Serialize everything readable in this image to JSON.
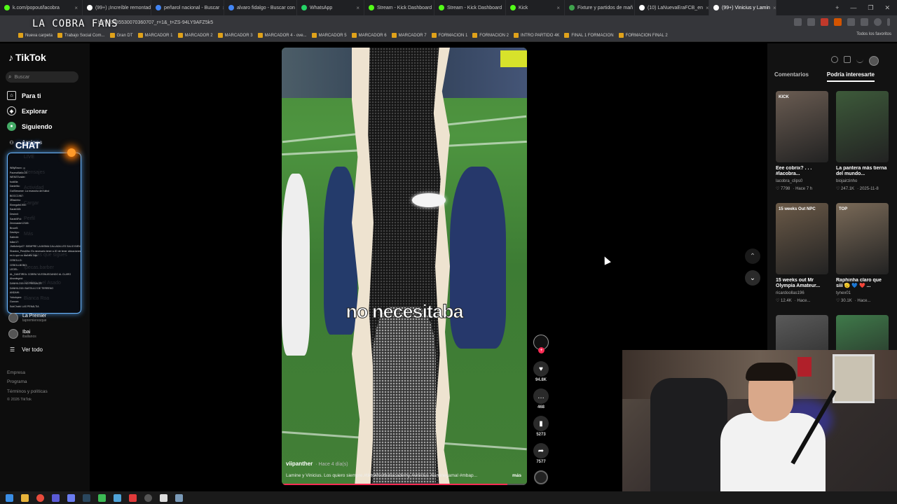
{
  "browser": {
    "tabs": [
      {
        "title": "k.com/popout/lacobra",
        "color": "#53fc18"
      },
      {
        "title": "(99+) ¡Increíble remontada",
        "color": "#ffffff"
      },
      {
        "title": "peñarol nacional - Buscar",
        "color": "#4285f4"
      },
      {
        "title": "alvaro fidalgo - Buscar con",
        "color": "#4285f4"
      },
      {
        "title": "WhatsApp",
        "color": "#25d366"
      },
      {
        "title": "Stream - Kick Dashboard",
        "color": "#53fc18"
      },
      {
        "title": "Stream - Kick Dashboard",
        "color": "#53fc18"
      },
      {
        "title": "Kick",
        "color": "#53fc18"
      },
      {
        "title": "Fixture y partidos de mañ",
        "color": "#3fa34d"
      },
      {
        "title": "(10) LaNuevaEraFCB_en",
        "color": "#ffffff"
      },
      {
        "title": "(99+) Vinicius y Lamin",
        "color": "#ffffff"
      }
    ],
    "url": "b/7610885530070360707_r=1&_t=ZS-94LY9AFZ5k5",
    "bookmarks": [
      "Nueva carpeta",
      "Trabajo Social Com...",
      "Gran DT",
      "MARCADOR 1",
      "MARCADOR 2",
      "MARCADOR 3",
      "MARCADOR 4 - ove...",
      "MARCADOR 5",
      "MARCADOR 6",
      "MARCADOR 7",
      "FORMACION 1",
      "FORMACION 2",
      "INTRO PARTIDO 4K",
      "FINAL 1 FORMACION",
      "FORMACION FINAL 2"
    ],
    "all_favorites": "Todos los favoritos"
  },
  "overlay": {
    "title": "LA COBRA FANS",
    "chat_title": "CHAT"
  },
  "sidebar": {
    "logo": "TikTok",
    "search_placeholder": "Buscar",
    "nav": [
      {
        "label": "Para ti",
        "icon": "home-icon"
      },
      {
        "label": "Explorar",
        "icon": "compass-icon"
      },
      {
        "label": "Siguiendo",
        "icon": "following-icon"
      },
      {
        "label": "Amigos",
        "icon": "friends-icon"
      }
    ],
    "ghost_items": [
      "LIVE",
      "Mensajes",
      "Actividad",
      "Cargar",
      "Perfil",
      "Más",
      "Cuentas que sigues",
      "Ipecas.barber",
      "Pedro y el Asado",
      "Bianca Roa"
    ],
    "followed": [
      {
        "name": "La Premier",
        "handle": "lapremieresque"
      },
      {
        "name": "Ibai",
        "handle": "iballanos"
      }
    ],
    "see_all": "Ver todo",
    "footer": [
      "Empresa",
      "Programa",
      "Términos y políticas",
      "© 2026 TikTok"
    ]
  },
  "video": {
    "caption": "no necesitaba",
    "author": "viipanther",
    "time": "· Hace 4 día(s)",
    "description": "Lamine y Vinicius. Los quiero siempre.#tiktokfootballacademy #vinicius #lamineyamal #mbap...",
    "more": "más",
    "progress": 0.92,
    "likes": "94.8K",
    "comments": "468",
    "saves": "5273",
    "shares": "7577"
  },
  "right_panel": {
    "tabs": [
      "Comentarios",
      "Podría interesarte"
    ],
    "active_tab": "Podría interesarte",
    "items": [
      {
        "title": "Eee cobrix? . . . #lacobra...",
        "author": "lacobra_clips0",
        "likes": "7798",
        "time": "· Hace 7 h",
        "bg": "#6a5c52",
        "thumb_text": "KICK"
      },
      {
        "title": "La pantera más tierna del mundo...",
        "author": "biojairzinho",
        "likes": "247.1K",
        "time": "· 2025-11-8",
        "bg": "#3d5a3a",
        "thumb_text": ""
      },
      {
        "title": "15 weeks out Mr Olympia Amateur...",
        "author": "ricardoollas196",
        "likes": "12.4K",
        "time": "· Hace...",
        "bg": "#6b5a48",
        "thumb_text": "15 weeks Out NPC"
      },
      {
        "title": "Raphinha claro que siii 🫡 💙 ❤️ ...",
        "author": "tynex01",
        "likes": "30.1K",
        "time": "· Hace...",
        "bg": "#7a6a58",
        "thumb_text": "TOP"
      },
      {
        "title": "",
        "author": "",
        "likes": "",
        "time": "",
        "bg": "#5a5a5a",
        "thumb_text": ""
      },
      {
        "title": "",
        "author": "",
        "likes": "",
        "time": "",
        "bg": "#3f7a4a",
        "thumb_text": ""
      }
    ]
  },
  "chat_lines": [
    "WillyBravo: ¡¡¡",
    "PaceraWallo 23",
    "WENSTunder:",
    "fucklilia",
    "Danielito:",
    "GolStreamer: La revancha del futbol",
    "BiOCC1967:",
    "3Rasinho:",
    "Elmegafe1994:",
    "Sarah345:",
    "Desimil:",
    "Sarah5Ful:",
    "Zenmaster12345:",
    "Bruce5:",
    "Davidyo:",
    "Saferdir:",
    "Isllan17:",
    "Jhellohelpr27: SIEMPRE LA MISMA CALLADA LES SALIO BIEN",
    "Shaston_Perutilho: Es necesario tener a JD de tener ubicaciones",
    "es lo que no dial ello Juju",
    "CEBOLLO:",
    "CEBOLLBOBO:",
    "LEOEL:",
    "AL_DANTIREA: COBRA YA ESNUEGANDO AL CLARO",
    "Ahowlegriol:",
    "DANHILO15: NO PREDALTE",
    "DANHILO15: BASTA A 2 DE TERRENO",
    "ANDAHI:",
    "Yobolopez:",
    "Gvcrom:",
    "SubChobl: LAS PENALTIA"
  ],
  "status": {
    "accent": "#fe2c55",
    "chat_border": "#6ab6ff"
  }
}
